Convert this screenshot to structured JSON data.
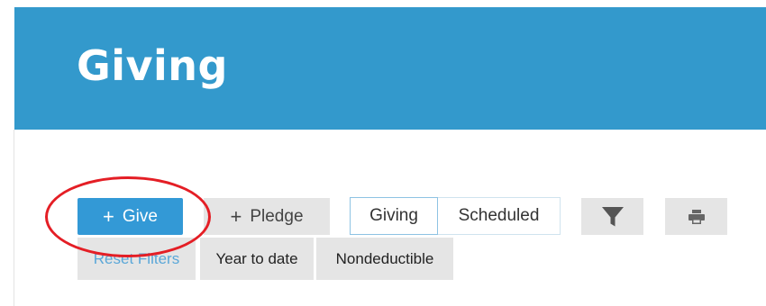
{
  "header": {
    "title": "Giving",
    "background_color": "#3399cc"
  },
  "toolbar": {
    "give_button": {
      "icon": "plus-icon",
      "plus": "+",
      "label": "Give",
      "color": "#3399d6"
    },
    "pledge_button": {
      "icon": "plus-icon",
      "plus": "+",
      "label": "Pledge"
    },
    "view_toggle": {
      "options": [
        "Giving",
        "Scheduled"
      ],
      "selected": "Giving"
    },
    "filter_button": {
      "icon": "filter-icon"
    },
    "print_button": {
      "icon": "print-icon"
    }
  },
  "filters": {
    "reset_label": "Reset Filters",
    "chips": [
      "Year to date",
      "Nondeductible"
    ]
  },
  "annotation": {
    "shape": "ellipse",
    "color": "#e41e25",
    "highlights": "give_button"
  }
}
